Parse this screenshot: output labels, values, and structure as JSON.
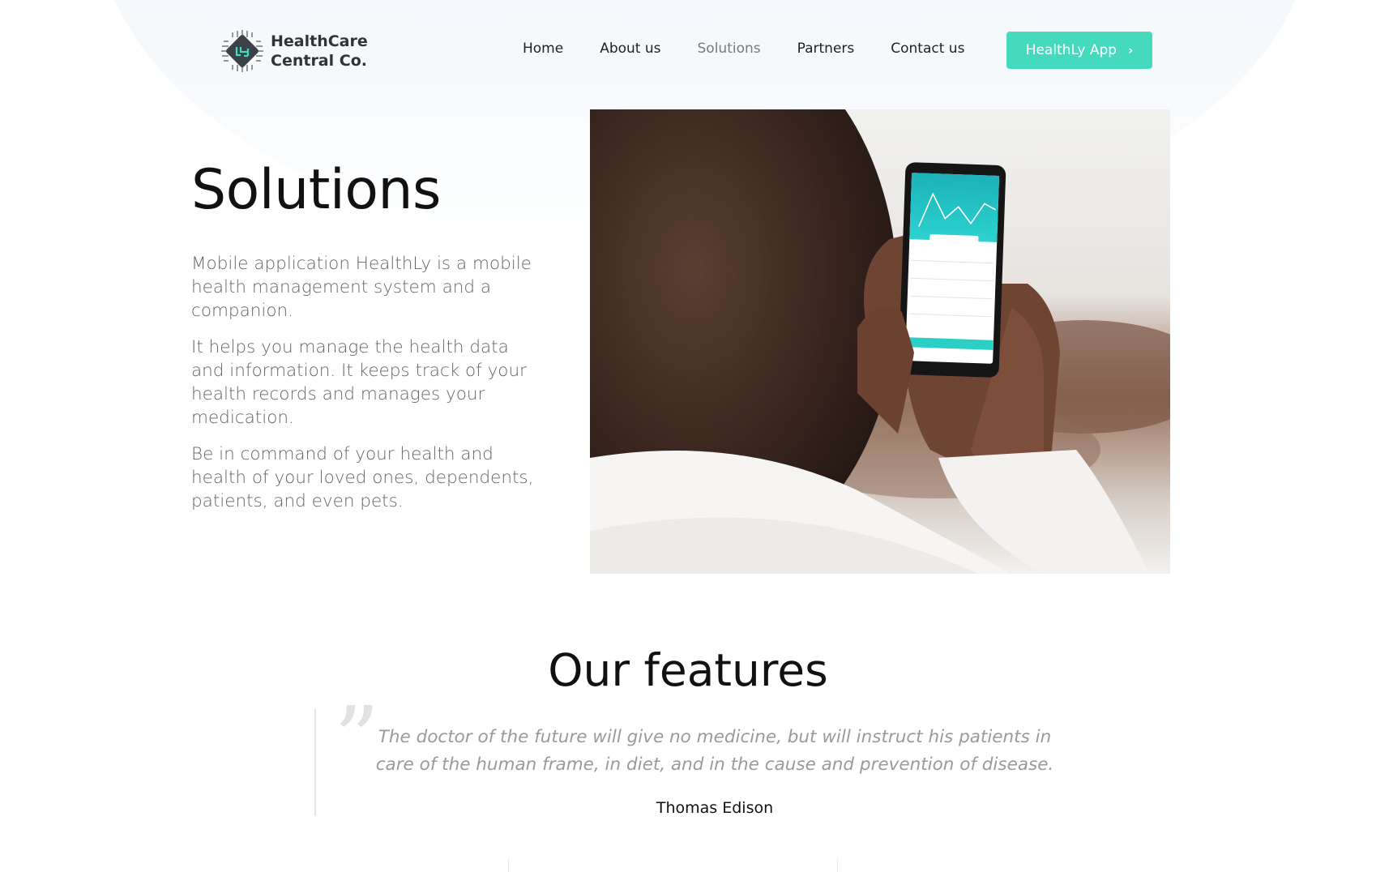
{
  "brand": {
    "line1": "HealthCare",
    "line2": "Central Co.",
    "logo_icon": "chip-logo-icon",
    "accent": "#45d9be"
  },
  "nav": {
    "items": [
      {
        "label": "Home",
        "active": false
      },
      {
        "label": "About us",
        "active": false
      },
      {
        "label": "Solutions",
        "active": true
      },
      {
        "label": "Partners",
        "active": false
      },
      {
        "label": "Contact us",
        "active": false
      }
    ],
    "cta_label": "HealthLy App",
    "cta_icon": "chevron-right-icon"
  },
  "hero": {
    "title": "Solutions",
    "paragraphs": [
      "Mobile application HealthLy is a mobile health management system and a companion.",
      "It helps you manage the health data and information. It keeps track of your health records and manages your medication.",
      "Be in command of your health and health of your loved ones, dependents, patients, and even pets."
    ],
    "image_alt": "person-holding-phone-photo"
  },
  "features": {
    "title": "Our features",
    "quote": "The doctor of the future will give no medicine, but will instruct his patients in care of the human frame, in diet, and in the cause and prevention of disease.",
    "author": "Thomas Edison",
    "quote_icon": "quote-icon"
  }
}
